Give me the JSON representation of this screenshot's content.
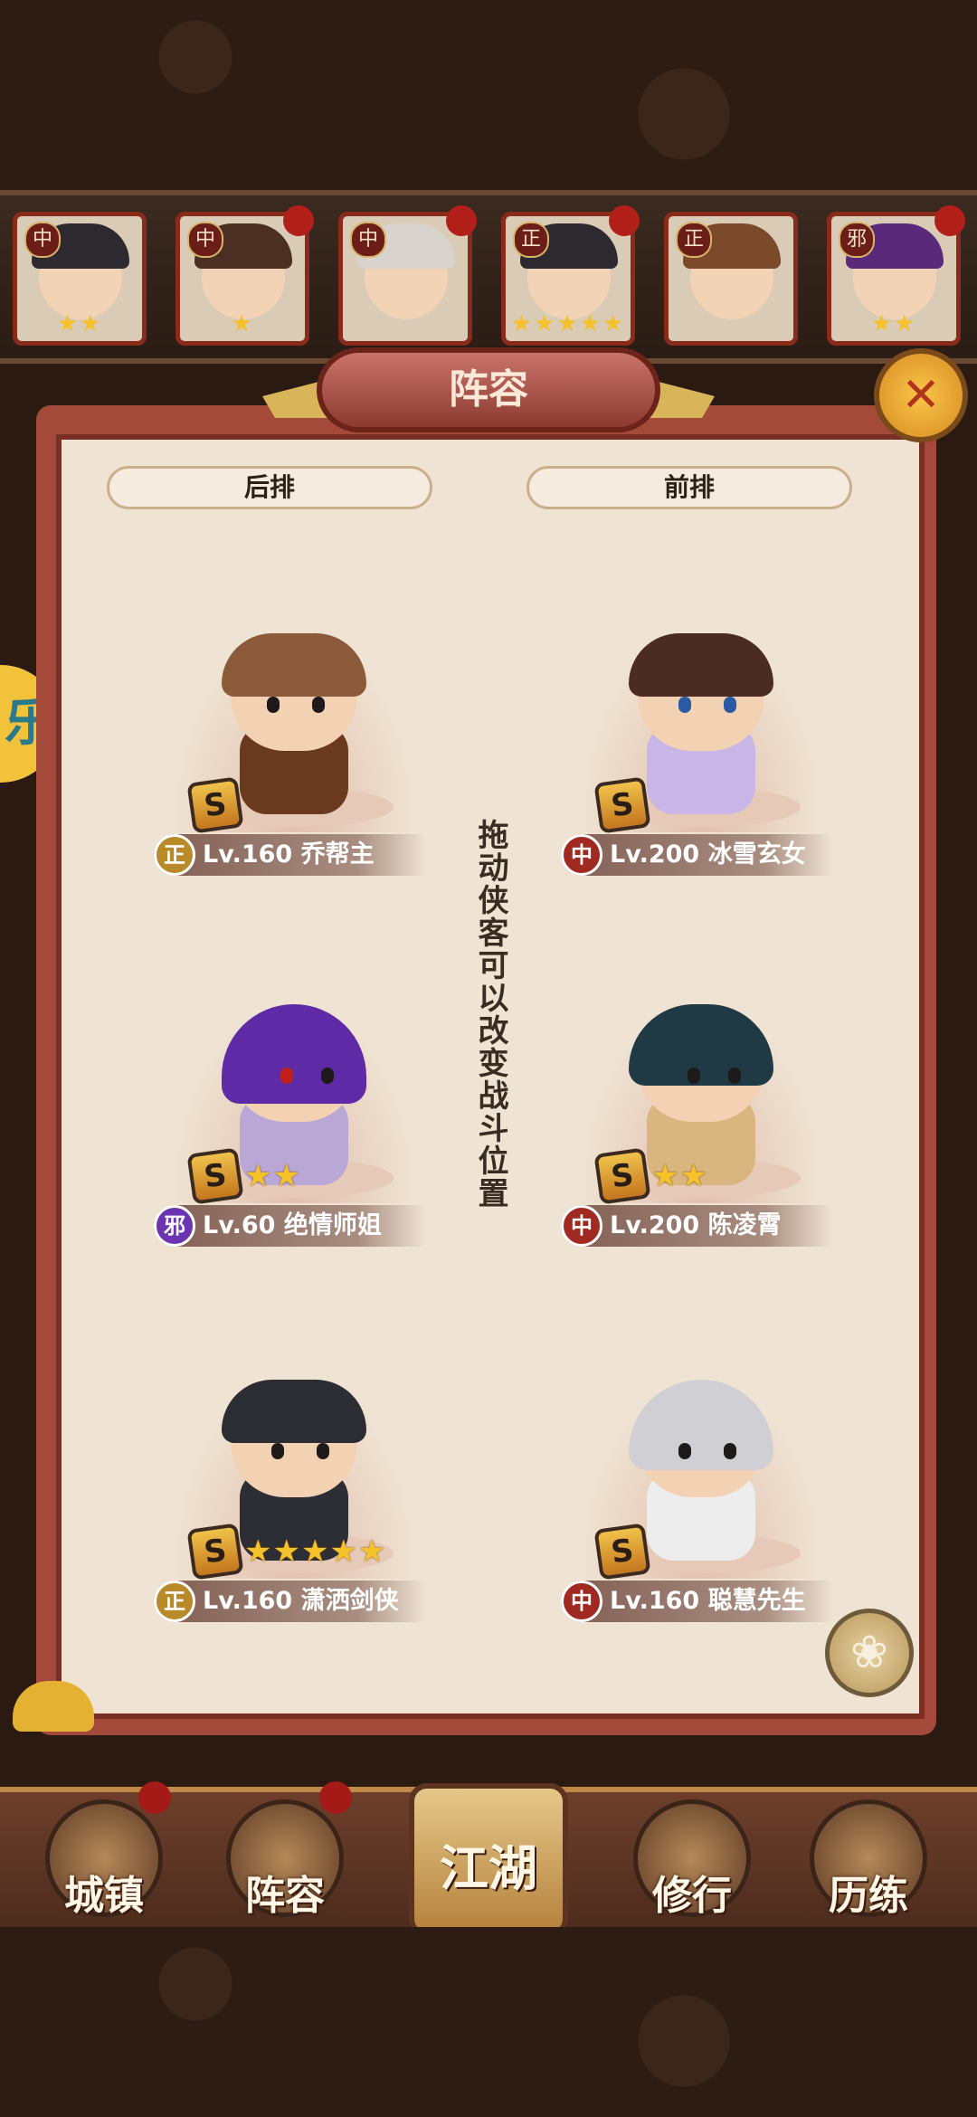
{
  "hero_strip": [
    {
      "faction": "中",
      "stars": "★★",
      "hair_color": "#2a2a33"
    },
    {
      "faction": "中",
      "stars": "★",
      "hair_color": "#4a2f22"
    },
    {
      "faction": "中",
      "stars": "",
      "hair_color": "#d8d3cc"
    },
    {
      "faction": "正",
      "stars": "★★★★★",
      "hair_color": "#2b2b2b"
    },
    {
      "faction": "正",
      "stars": "",
      "hair_color": "#7a4a2a"
    },
    {
      "faction": "邪",
      "stars": "★★",
      "hair_color": "#5a2a7a"
    }
  ],
  "panel": {
    "title": "阵容",
    "back_row_label": "后排",
    "front_row_label": "前排",
    "hint": "拖动侠客可以改变战斗位置"
  },
  "slots": {
    "back_1": {
      "grade": "S",
      "stars": "",
      "faction": "正",
      "faction_color": "#b88a2a",
      "level_name": "Lv.160 乔帮主",
      "hair_color": "#8a5a3a",
      "body_color": "#6a3a1e"
    },
    "back_2": {
      "grade": "S",
      "stars": "★★",
      "faction": "邪",
      "faction_color": "#6b34b0",
      "level_name": "Lv.60 绝情师姐",
      "hair_color": "#5e2aa5",
      "body_color": "#b9a7d6"
    },
    "back_3": {
      "grade": "S",
      "stars": "★★★★★",
      "faction": "正",
      "faction_color": "#b88a2a",
      "level_name": "Lv.160 潇洒剑侠",
      "hair_color": "#2c2c33",
      "body_color": "#2d2d35"
    },
    "front_1": {
      "grade": "S",
      "stars": "",
      "faction": "中",
      "faction_color": "#a02a22",
      "level_name": "Lv.200 冰雪玄女",
      "hair_color": "#4a2c22",
      "body_color": "#c7b6e6"
    },
    "front_2": {
      "grade": "S",
      "stars": "★★",
      "faction": "中",
      "faction_color": "#a02a22",
      "level_name": "Lv.200 陈凌霄",
      "hair_color": "#1f3a44",
      "body_color": "#d9b680"
    },
    "front_3": {
      "grade": "S",
      "stars": "",
      "faction": "中",
      "faction_color": "#a02a22",
      "level_name": "Lv.160 聪慧先生",
      "hair_color": "#cfcfd4",
      "body_color": "#ededed"
    }
  },
  "nav": {
    "town": "城镇",
    "lineup": "阵容",
    "jianghu": "江湖",
    "cultivate": "修行",
    "train": "历练"
  },
  "side_deco_char": "乐"
}
